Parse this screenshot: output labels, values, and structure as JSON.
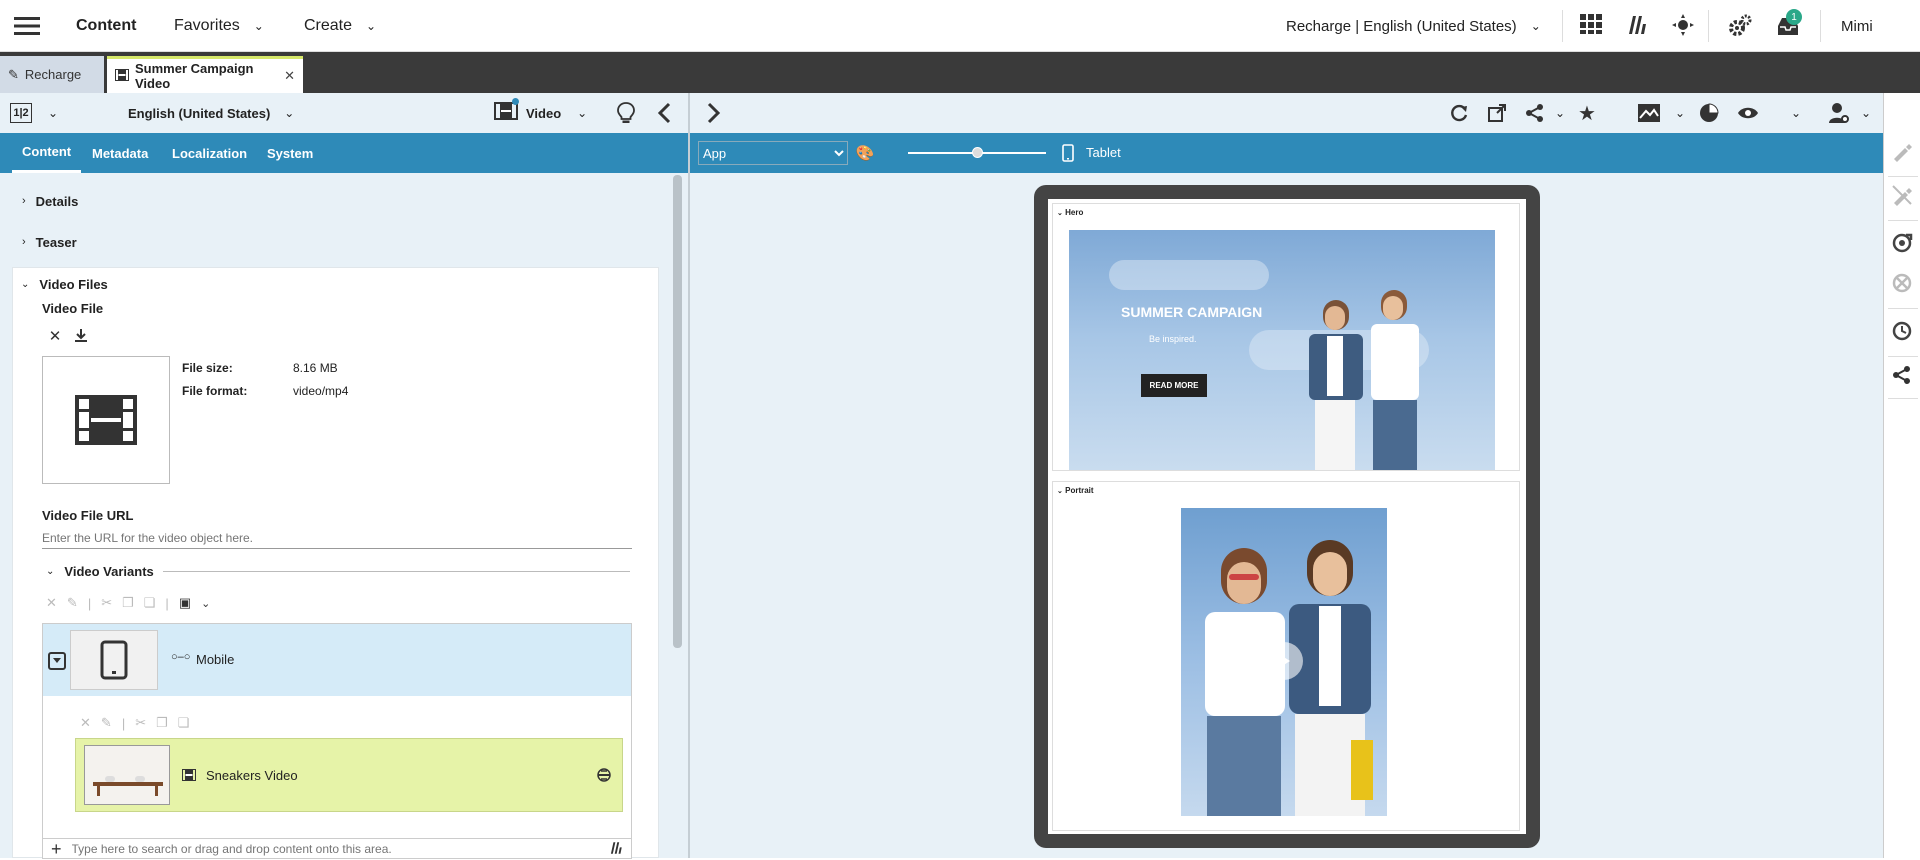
{
  "topbar": {
    "app_title": "Content",
    "favorites": "Favorites",
    "create": "Create",
    "site_locale": "Recharge | English (United States)",
    "notification_count": "1",
    "user": "Mimi"
  },
  "tabs": [
    {
      "label": "Recharge"
    },
    {
      "label": "Summer Campaign Video"
    }
  ],
  "editor": {
    "locale": "English (United States)",
    "doctype": "Video",
    "tabs": [
      "Content",
      "Metadata",
      "Localization",
      "System"
    ],
    "sections": {
      "details": "Details",
      "teaser": "Teaser",
      "video_files": "Video Files"
    },
    "video_file_label": "Video File",
    "file_size_label": "File size:",
    "file_size_value": "8.16 MB",
    "file_format_label": "File format:",
    "file_format_value": "video/mp4",
    "url_label": "Video File URL",
    "url_placeholder": "Enter the URL for the video object here.",
    "variants_label": "Video Variants",
    "variant_mobile": "Mobile",
    "variant_child": "Sneakers Video",
    "drop_placeholder": "Type here to search or drag and drop content onto this area."
  },
  "preview": {
    "channel_select": "App",
    "device_label": "Tablet",
    "zoom_fraction": 0.5,
    "hero_label": "Hero",
    "portrait_label": "Portrait",
    "hero_headline": "SUMMER CAMPAIGN",
    "hero_sub": "Be inspired.",
    "hero_button": "READ MORE"
  },
  "colors": {
    "accent": "#2e8ab8",
    "editor_bg": "#e8f1f7",
    "selected_row": "#d5ebf8",
    "child_row": "#e6f3a8",
    "tab_active_accent": "#d6e86a",
    "badge": "#2aa889"
  }
}
